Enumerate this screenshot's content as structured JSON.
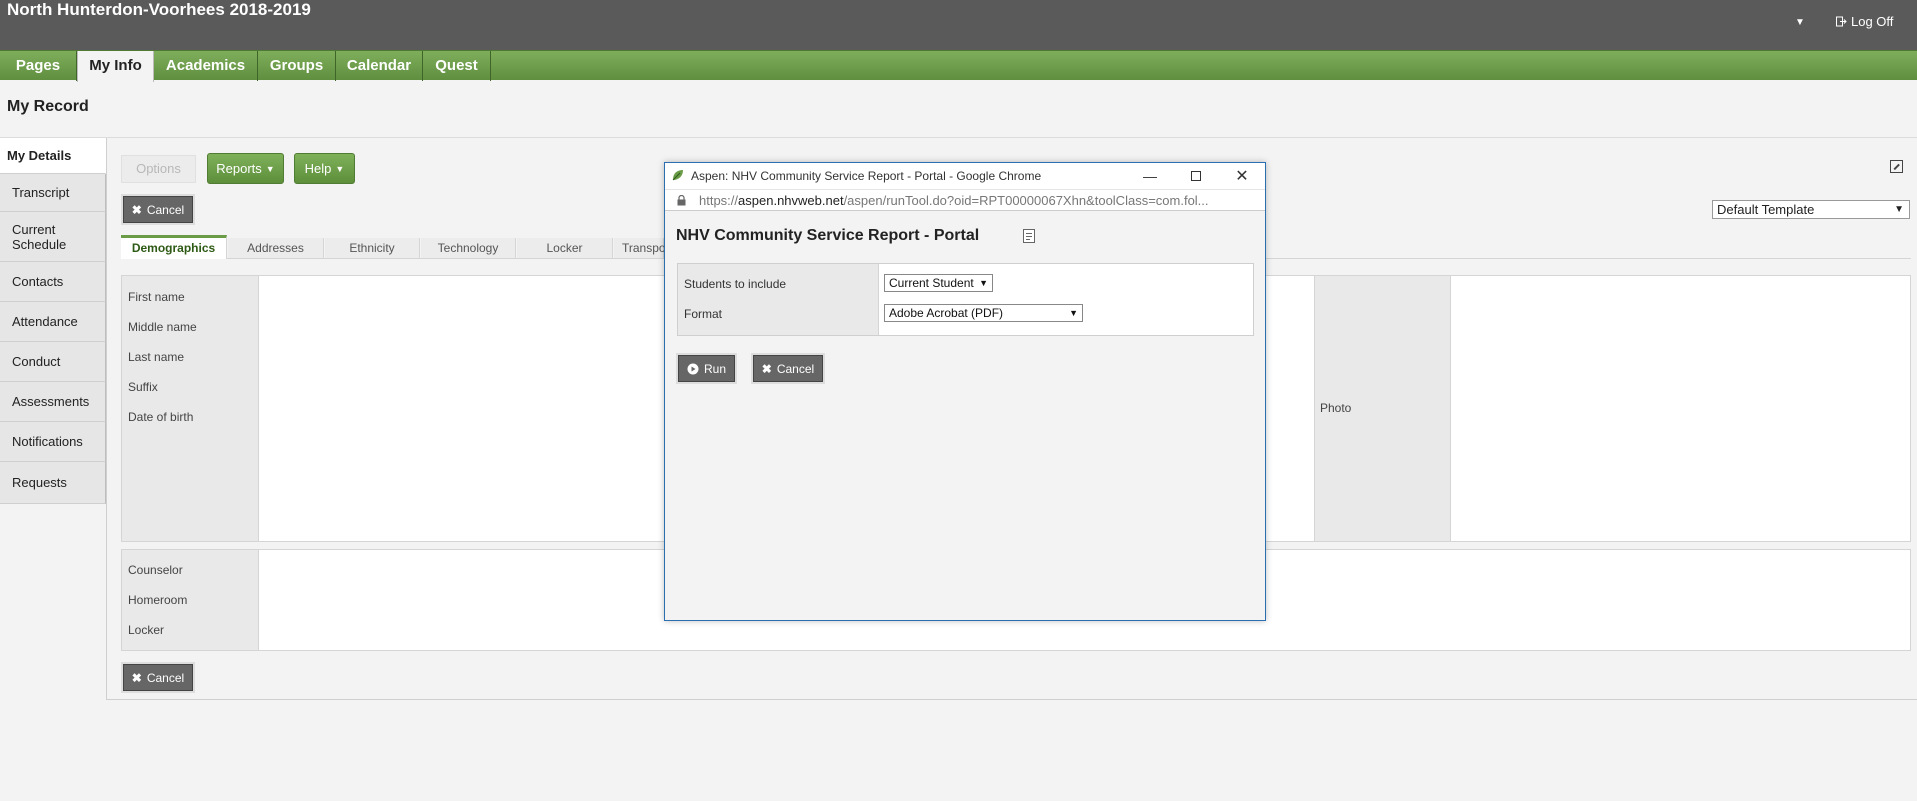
{
  "header": {
    "school_title": "North Hunterdon-Voorhees 2018-2019",
    "logoff_label": "Log Off"
  },
  "nav": {
    "tabs": [
      "Pages",
      "My Info",
      "Academics",
      "Groups",
      "Calendar",
      "Quest"
    ],
    "active": "My Info"
  },
  "page": {
    "title": "My Record"
  },
  "sidebar": {
    "items": [
      {
        "label": "My Details"
      },
      {
        "label": "Transcript"
      },
      {
        "label": "Current\nSchedule"
      },
      {
        "label": "Contacts"
      },
      {
        "label": "Attendance"
      },
      {
        "label": "Conduct"
      },
      {
        "label": "Assessments"
      },
      {
        "label": "Notifications"
      },
      {
        "label": "Requests"
      }
    ]
  },
  "toolbar": {
    "options_label": "Options",
    "reports_label": "Reports",
    "help_label": "Help",
    "cancel_label": "Cancel"
  },
  "template": {
    "selected": "Default Template"
  },
  "subtabs": [
    "Demographics",
    "Addresses",
    "Ethnicity",
    "Technology",
    "Locker",
    "Transpo"
  ],
  "form": {
    "fields": [
      "First name",
      "Middle name",
      "Last name",
      "Suffix",
      "Date of birth"
    ],
    "photo_label": "Photo",
    "fields2": [
      "Counselor",
      "Homeroom",
      "Locker"
    ]
  },
  "popup": {
    "window_title": "Aspen: NHV Community Service Report - Portal - Google Chrome",
    "url_prefix": "https://",
    "url_host": "aspen.nhvweb.net",
    "url_path": "/aspen/runTool.do?oid=RPT00000067Xhn&toolClass=com.fol...",
    "heading": "NHV Community Service Report - Portal",
    "students_label": "Students to include",
    "students_value": "Current Student",
    "format_label": "Format",
    "format_value": "Adobe Acrobat (PDF)",
    "run_label": "Run",
    "cancel_label": "Cancel"
  }
}
